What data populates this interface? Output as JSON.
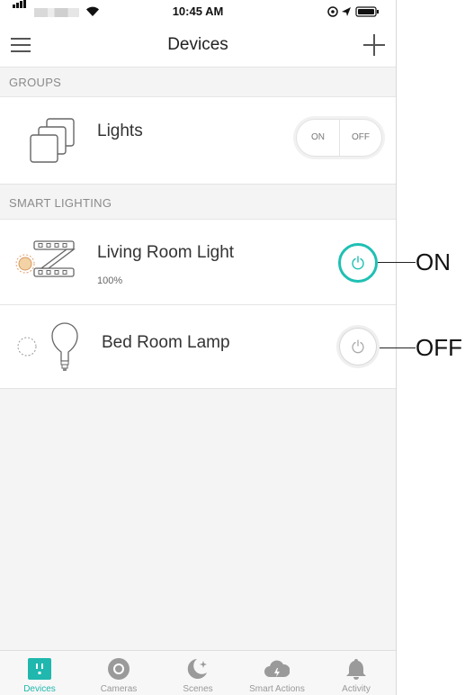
{
  "status_bar": {
    "time": "10:45 AM"
  },
  "nav": {
    "title": "Devices"
  },
  "sections": {
    "groups": "GROUPS",
    "smart_lighting": "SMART LIGHTING"
  },
  "group": {
    "name": "Lights",
    "toggle_on": "ON",
    "toggle_off": "OFF"
  },
  "devices": [
    {
      "name": "Living Room Light",
      "brightness": "100%",
      "state": "on",
      "icon": "light-strip-icon"
    },
    {
      "name": "Bed Room Lamp",
      "state": "off",
      "icon": "bulb-icon"
    }
  ],
  "annotations": {
    "on": "ON",
    "off": "OFF"
  },
  "colors": {
    "accent": "#1fc0b3",
    "bulb_on": "#f3d3a5"
  },
  "tabs": [
    {
      "label": "Devices",
      "icon": "devices-icon",
      "active": true
    },
    {
      "label": "Cameras",
      "icon": "camera-icon",
      "active": false
    },
    {
      "label": "Scenes",
      "icon": "scenes-icon",
      "active": false
    },
    {
      "label": "Smart Actions",
      "icon": "smart-actions-icon",
      "active": false
    },
    {
      "label": "Activity",
      "icon": "bell-icon",
      "active": false
    }
  ]
}
